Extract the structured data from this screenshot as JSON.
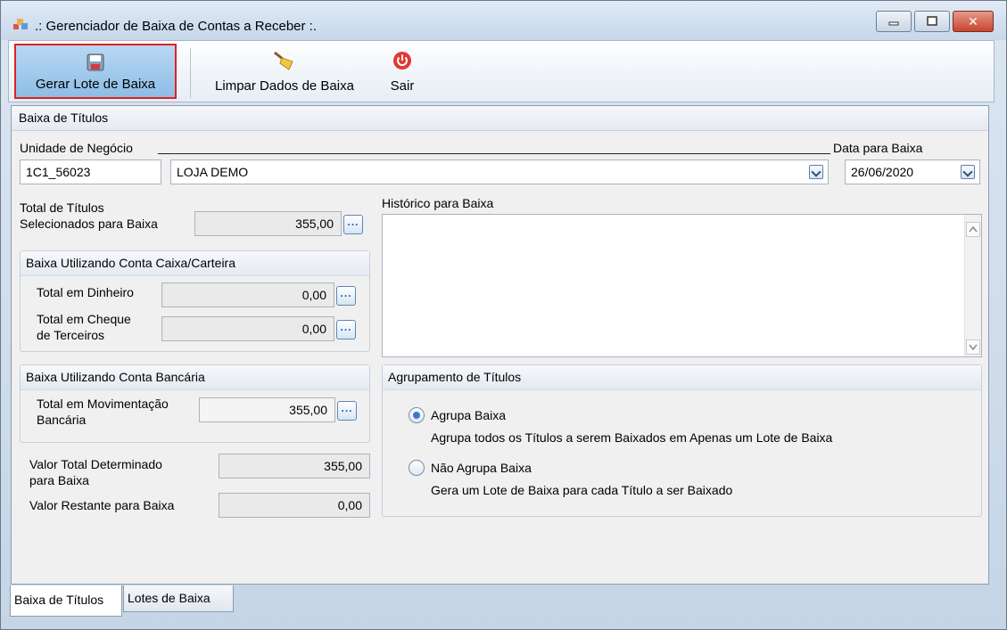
{
  "window": {
    "title": ".: Gerenciador de Baixa de Contas a Receber :.",
    "controls": {
      "minimize": "▭",
      "maximize": "▢",
      "close": "✕"
    }
  },
  "toolbar": {
    "gerar_label": "Gerar Lote de Baixa",
    "limpar_label": "Limpar Dados de Baixa",
    "sair_label": "Sair"
  },
  "panel": {
    "title": "Baixa de Títulos"
  },
  "unidade": {
    "label": "Unidade de Negócio",
    "code": "1C1_56023",
    "name": "LOJA DEMO"
  },
  "data_baixa": {
    "label": "Data para Baixa",
    "value": "26/06/2020"
  },
  "total_titulos": {
    "label_line1": "Total de Títulos",
    "label_line2": "Selecionados para Baixa",
    "value": "355,00"
  },
  "historico": {
    "label": "Histórico para Baixa",
    "value": ""
  },
  "caixa_group": {
    "title": "Baixa Utilizando Conta Caixa/Carteira",
    "dinheiro_label": "Total em Dinheiro",
    "dinheiro_value": "0,00",
    "cheque_label_line1": "Total em Cheque",
    "cheque_label_line2": "de Terceiros",
    "cheque_value": "0,00"
  },
  "bancaria_group": {
    "title": "Baixa Utilizando Conta Bancária",
    "mov_label_line1": "Total em Movimentação",
    "mov_label_line2": "Bancária",
    "mov_value": "355,00"
  },
  "valor_total": {
    "label_line1": "Valor Total Determinado",
    "label_line2": "para Baixa",
    "value": "355,00"
  },
  "valor_restante": {
    "label": "Valor Restante para Baixa",
    "value": "0,00"
  },
  "agrupamento": {
    "title": "Agrupamento de Títulos",
    "opt1_label": "Agrupa Baixa",
    "opt1_desc": "Agrupa todos os Títulos a serem Baixados em Apenas um Lote de Baixa",
    "opt1_selected": true,
    "opt2_label": "Não Agrupa Baixa",
    "opt2_desc": "Gera um Lote de Baixa para cada Título a ser Baixado",
    "opt2_selected": false
  },
  "tabs": [
    {
      "label": "Baixa de Títulos",
      "selected": true
    },
    {
      "label": "Lotes de Baixa",
      "selected": false
    }
  ],
  "colors": {
    "accent": "#3e79c2",
    "active_outline": "#e0211f",
    "readonly_bg": "#eaeaea"
  }
}
